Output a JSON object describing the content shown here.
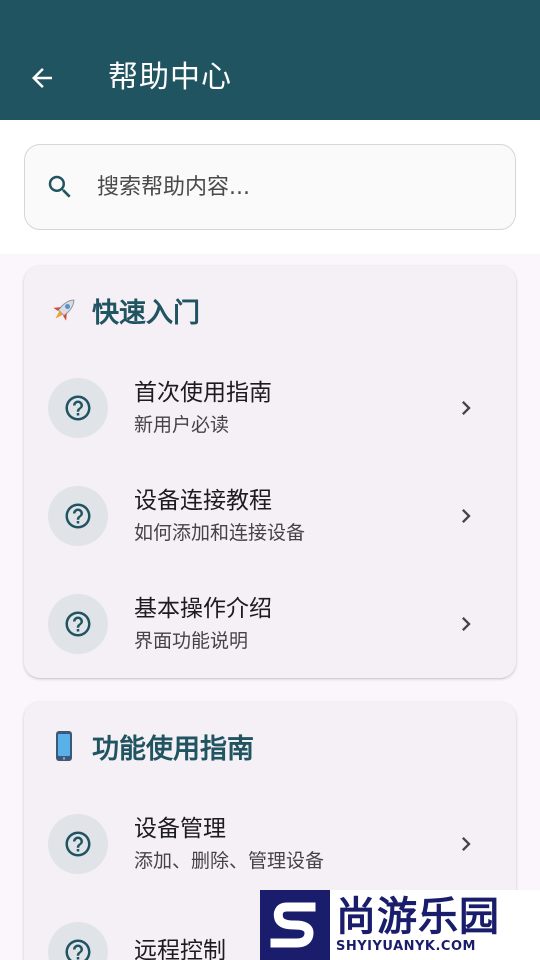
{
  "appbar": {
    "title": "帮助中心"
  },
  "search": {
    "placeholder": "搜索帮助内容..."
  },
  "sections": [
    {
      "title": "快速入门",
      "icon": "rocket-icon",
      "items": [
        {
          "title": "首次使用指南",
          "subtitle": "新用户必读"
        },
        {
          "title": "设备连接教程",
          "subtitle": "如何添加和连接设备"
        },
        {
          "title": "基本操作介绍",
          "subtitle": "界面功能说明"
        }
      ]
    },
    {
      "title": "功能使用指南",
      "icon": "mobile-phone-icon",
      "items": [
        {
          "title": "设备管理",
          "subtitle": "添加、删除、管理设备"
        },
        {
          "title": "远程控制",
          "subtitle": ""
        }
      ]
    }
  ],
  "watermark": {
    "name": "尚游乐园",
    "domain": "SHYIYUANYK.COM"
  },
  "colors": {
    "primary": "#215461",
    "card": "#f5f0f6",
    "icon_bg": "#e0e3e8"
  }
}
